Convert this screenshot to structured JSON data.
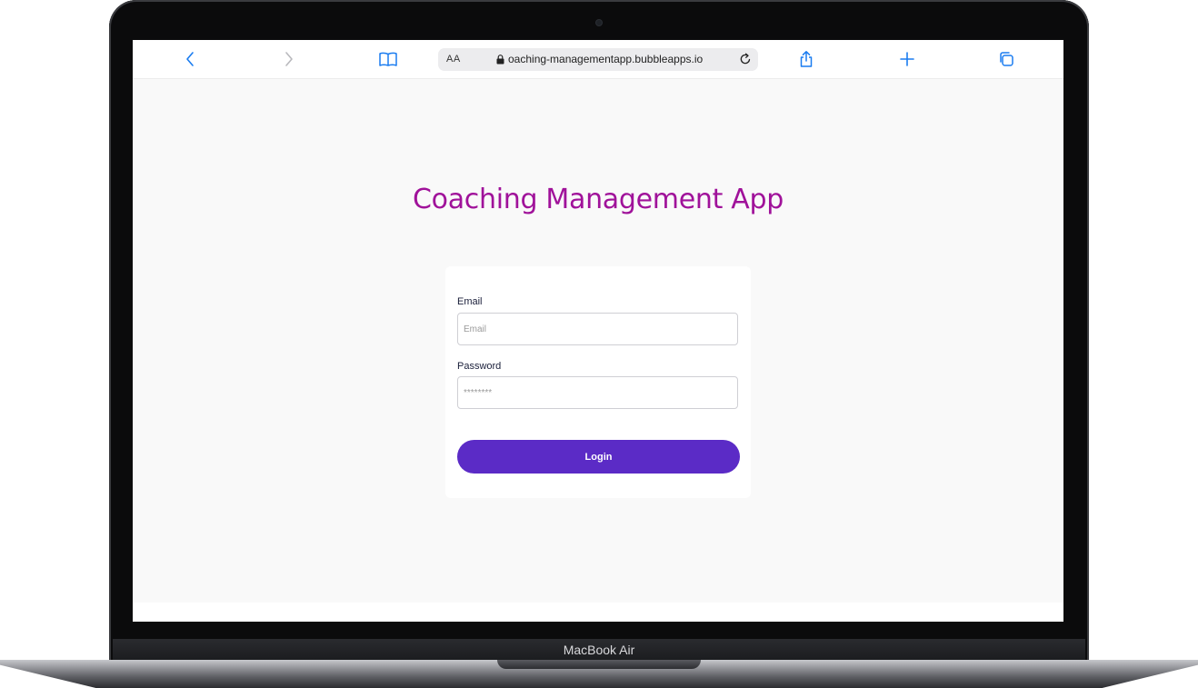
{
  "browser": {
    "address_text_size": "AA",
    "url": "oaching-managementapp.bubbleapps.io",
    "icons": [
      "back-icon",
      "forward-icon",
      "bookmarks-icon",
      "lock-icon",
      "reload-icon",
      "share-icon",
      "new-tab-icon",
      "tabs-icon"
    ]
  },
  "page": {
    "title": "Coaching Management App",
    "email_label": "Email",
    "email_placeholder": "Email",
    "password_label": "Password",
    "password_placeholder": "********",
    "login_label": "Login"
  },
  "device": {
    "label": "MacBook Air"
  },
  "colors": {
    "title": "#a0129a",
    "button": "#5b2bc6",
    "toolbar_accent": "#1a7cf0"
  }
}
